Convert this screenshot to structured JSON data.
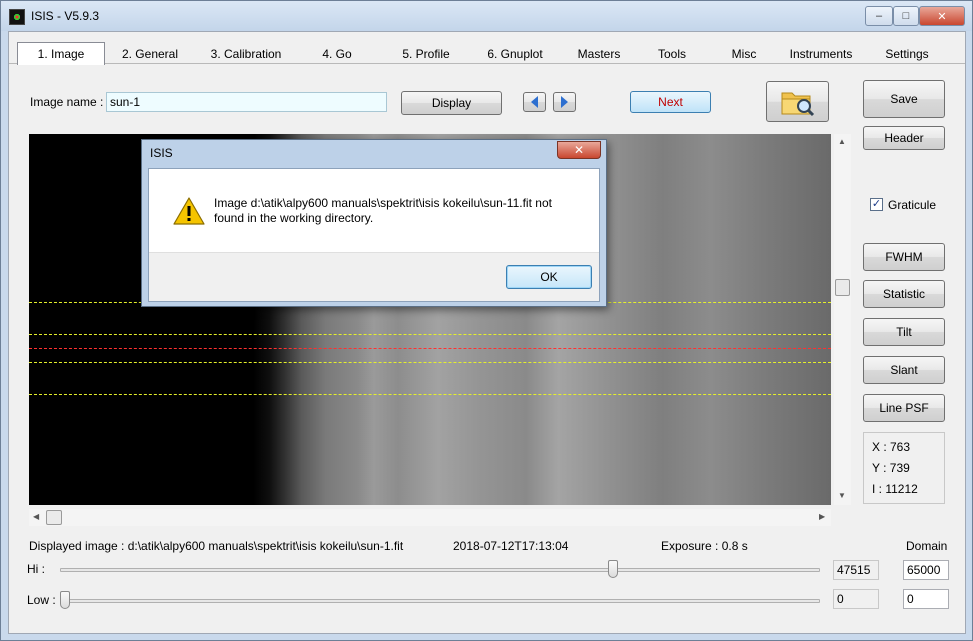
{
  "window": {
    "title": "ISIS - V5.9.3",
    "minimize": "–",
    "maximize": "□",
    "close": "✕"
  },
  "tabs": [
    {
      "label": "1. Image",
      "active": true
    },
    {
      "label": "2. General"
    },
    {
      "label": "3. Calibration"
    },
    {
      "label": "4. Go"
    },
    {
      "label": "5. Profile"
    },
    {
      "label": "6. Gnuplot"
    },
    {
      "label": "Masters"
    },
    {
      "label": "Tools"
    },
    {
      "label": "Misc"
    },
    {
      "label": "Instruments"
    },
    {
      "label": "Settings"
    }
  ],
  "toolbar": {
    "image_name_label": "Image name :",
    "image_name_value": "sun-1",
    "display_label": "Display",
    "next_label": "Next",
    "save_label": "Save",
    "header_label": "Header"
  },
  "side": {
    "graticule_label": "Graticule",
    "graticule_checked": true,
    "buttons": [
      "FWHM",
      "Statistic",
      "Tilt",
      "Slant",
      "Line PSF"
    ]
  },
  "coords": {
    "x": "X : 763",
    "y": "Y : 739",
    "i": "I :  11212"
  },
  "status": {
    "displayed_image": "Displayed image : d:\\atik\\alpy600 manuals\\spektrit\\isis kokeilu\\sun-1.fit",
    "timestamp": "2018-07-12T17:13:04",
    "exposure": "Exposure : 0.8 s",
    "domain_label": "Domain"
  },
  "levels": {
    "hi_label": "Hi :",
    "low_label": "Low :",
    "hi_value": "47515",
    "low_value": "0",
    "domain_max": "65000",
    "domain_min": "0",
    "hi_fraction": 0.73,
    "low_fraction": 0.0
  },
  "dialog": {
    "title": "ISIS",
    "close": "✕",
    "message": "Image d:\\atik\\alpy600 manuals\\spektrit\\isis kokeilu\\sun-11.fit not found in the working directory.",
    "ok_label": "OK"
  }
}
